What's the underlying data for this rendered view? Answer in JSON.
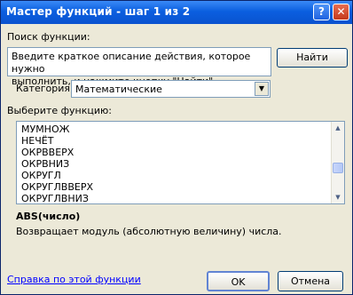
{
  "window": {
    "title": "Мастер функций - шаг 1 из 2",
    "help_glyph": "?",
    "close_glyph": "✕"
  },
  "search": {
    "label": "Поиск функции:",
    "text_line1": "Введите краткое описание действия, которое нужно",
    "text_line2": "выполнить, и нажмите кнопку \"Найти\"",
    "find_button": "Найти"
  },
  "category": {
    "label": "Категория:",
    "selected": "Математические"
  },
  "functions": {
    "label": "Выберите функцию:",
    "items": [
      "МУМНОЖ",
      "НЕЧЁТ",
      "ОКРВВЕРХ",
      "ОКРВНИЗ",
      "ОКРУГЛ",
      "ОКРУГЛВВЕРХ",
      "ОКРУГЛВНИЗ"
    ]
  },
  "selected_function": {
    "signature_name": "ABS",
    "signature_args": "(число)",
    "description": "Возвращает модуль (абсолютную величину) числа."
  },
  "footer": {
    "help_link": "Справка по этой функции",
    "ok": "OK",
    "cancel": "Отмена"
  }
}
